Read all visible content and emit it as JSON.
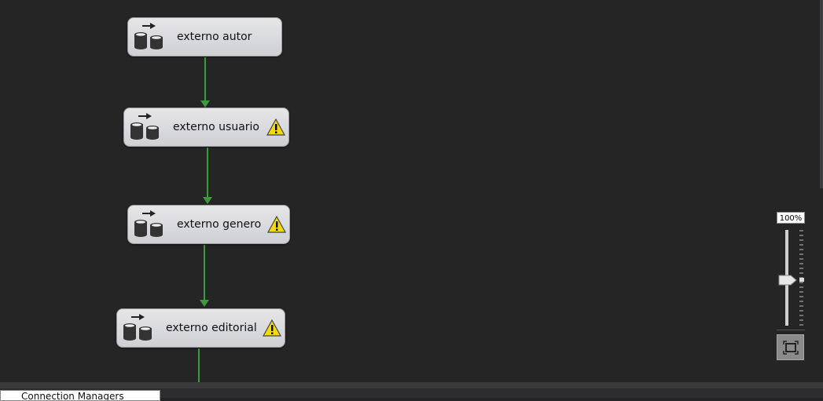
{
  "tasks": [
    {
      "label": "externo autor",
      "warning": false
    },
    {
      "label": "externo usuario",
      "warning": true
    },
    {
      "label": "externo genero",
      "warning": true
    },
    {
      "label": "externo editorial",
      "warning": true
    }
  ],
  "zoom": {
    "label": "100%",
    "level_percent": 100
  },
  "bottom_tab": {
    "label": "Connection Managers"
  },
  "colors": {
    "connector": "#3c9a3c",
    "canvas": "#252526",
    "task_bg": "#dcdcde",
    "warning": "#f5d90a"
  },
  "icons": {
    "task": "data-flow-task-icon",
    "warning": "warning-icon",
    "fit": "zoom-to-fit-icon"
  }
}
